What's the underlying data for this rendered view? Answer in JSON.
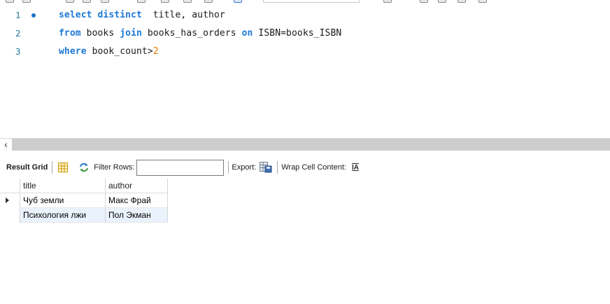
{
  "editor": {
    "lines": [
      {
        "number": "1",
        "has_marker": true,
        "tokens": [
          {
            "text": "select distinct",
            "kind": "kw"
          },
          {
            "text": "  title, author",
            "kind": "id"
          }
        ]
      },
      {
        "number": "2",
        "has_marker": false,
        "tokens": [
          {
            "text": "from",
            "kind": "kw"
          },
          {
            "text": " books ",
            "kind": "id"
          },
          {
            "text": "join",
            "kind": "kw"
          },
          {
            "text": " books_has_orders ",
            "kind": "id"
          },
          {
            "text": "on",
            "kind": "kw"
          },
          {
            "text": " ISBN=books_ISBN",
            "kind": "id"
          }
        ]
      },
      {
        "number": "3",
        "has_marker": false,
        "tokens": [
          {
            "text": "where",
            "kind": "kw"
          },
          {
            "text": " book_count>",
            "kind": "id"
          },
          {
            "text": "2",
            "kind": "num"
          }
        ]
      }
    ],
    "colors": {
      "keyword": "#1c78d6",
      "identifier": "#1a1a1a",
      "number": "#e07b00",
      "line_number": "#247a9b",
      "marker": "#1d73c9"
    }
  },
  "scrollbar": {
    "left_arrow": "‹"
  },
  "result_toolbar": {
    "result_grid_label": "Result Grid",
    "filter_rows_label": "Filter Rows:",
    "filter_value": "",
    "export_label": "Export:",
    "wrap_label": "Wrap Cell Content:",
    "wrap_icon_text": "IA"
  },
  "result_grid": {
    "columns": [
      "title",
      "author"
    ],
    "rows": [
      {
        "title": "Чуб земли",
        "author": "Макс Фрай",
        "current": true
      },
      {
        "title": "Психология лжи",
        "author": "Пол Экман",
        "current": false
      }
    ],
    "alt_row_color": "#eaf2fc"
  }
}
